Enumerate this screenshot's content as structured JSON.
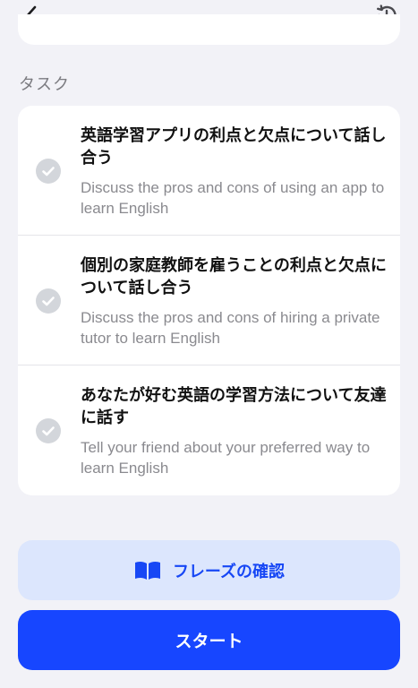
{
  "section_label": "タスク",
  "tasks": [
    {
      "title": "英語学習アプリの利点と欠点について話し合う",
      "subtitle": "Discuss the pros and cons of using an app to learn English",
      "completed": true
    },
    {
      "title": "個別の家庭教師を雇うことの利点と欠点について話し合う",
      "subtitle": "Discuss the pros and cons of hiring a private tutor to learn English",
      "completed": true
    },
    {
      "title": "あなたが好む英語の学習方法について友達に話す",
      "subtitle": "Tell your friend about your preferred way to learn English",
      "completed": true
    }
  ],
  "phrase_button": {
    "label": "フレーズの確認",
    "icon": "book-icon"
  },
  "start_button": {
    "label": "スタート"
  },
  "icons": {
    "back": "chevron-left-icon",
    "history": "history-icon",
    "check": "checkmark-icon"
  },
  "colors": {
    "accent": "#1746ff",
    "accent_light": "#dce6fd",
    "check_bg": "#d3d6db",
    "background": "#f2f2f7"
  }
}
